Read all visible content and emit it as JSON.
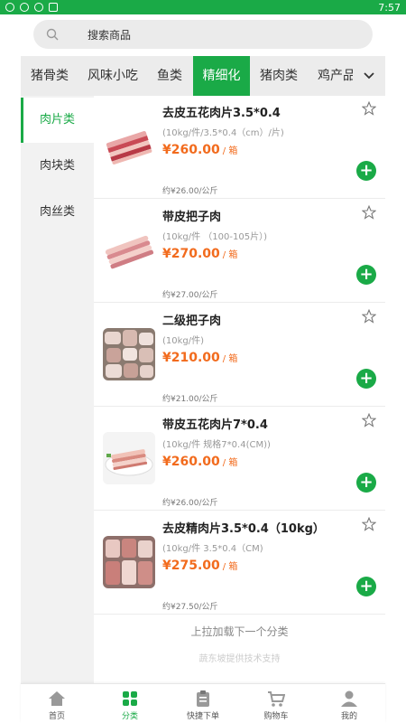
{
  "status_bar": {
    "time": "7:57"
  },
  "search": {
    "placeholder": "搜索商品"
  },
  "top_tabs": [
    {
      "label": "猪骨类"
    },
    {
      "label": "风味小吃"
    },
    {
      "label": "鱼类"
    },
    {
      "label": "精细化",
      "active": true
    },
    {
      "label": "猪肉类"
    },
    {
      "label": "鸡产品"
    }
  ],
  "side_categories": [
    {
      "label": "肉片类",
      "active": true
    },
    {
      "label": "肉块类"
    },
    {
      "label": "肉丝类"
    }
  ],
  "products": [
    {
      "name": "去皮五花肉片3.5*0.4",
      "spec": "(10kg/件/3.5*0.4（cm）/片)",
      "price": "¥260.00",
      "unit": "/ 箱",
      "per_kg": "约¥26.00/公斤"
    },
    {
      "name": "带皮把子肉",
      "spec": "(10kg/件 （100-105片）)",
      "price": "¥270.00",
      "unit": "/ 箱",
      "per_kg": "约¥27.00/公斤"
    },
    {
      "name": "二级把子肉",
      "spec": "(10kg/件)",
      "price": "¥210.00",
      "unit": "/ 箱",
      "per_kg": "约¥21.00/公斤"
    },
    {
      "name": "带皮五花肉片7*0.4",
      "spec": "(10kg/件 规格7*0.4(CM))",
      "price": "¥260.00",
      "unit": "/ 箱",
      "per_kg": "约¥26.00/公斤"
    },
    {
      "name": "去皮精肉片3.5*0.4（10kg）",
      "spec": "(10kg/件 3.5*0.4（CM)",
      "price": "¥275.00",
      "unit": "/ 箱",
      "per_kg": "约¥27.50/公斤"
    }
  ],
  "load_more": "上拉加载下一个分类",
  "support": "蔬东坡提供技术支持",
  "bottom_nav": [
    {
      "label": "首页",
      "icon": "home-icon"
    },
    {
      "label": "分类",
      "icon": "category-icon",
      "active": true
    },
    {
      "label": "快捷下单",
      "icon": "clipboard-icon"
    },
    {
      "label": "购物车",
      "icon": "cart-icon"
    },
    {
      "label": "我的",
      "icon": "user-icon"
    }
  ],
  "colors": {
    "brand": "#1aaa47",
    "price": "#f26b1d",
    "tab_bg": "#ececec",
    "side_bg": "#f2f2f2"
  }
}
